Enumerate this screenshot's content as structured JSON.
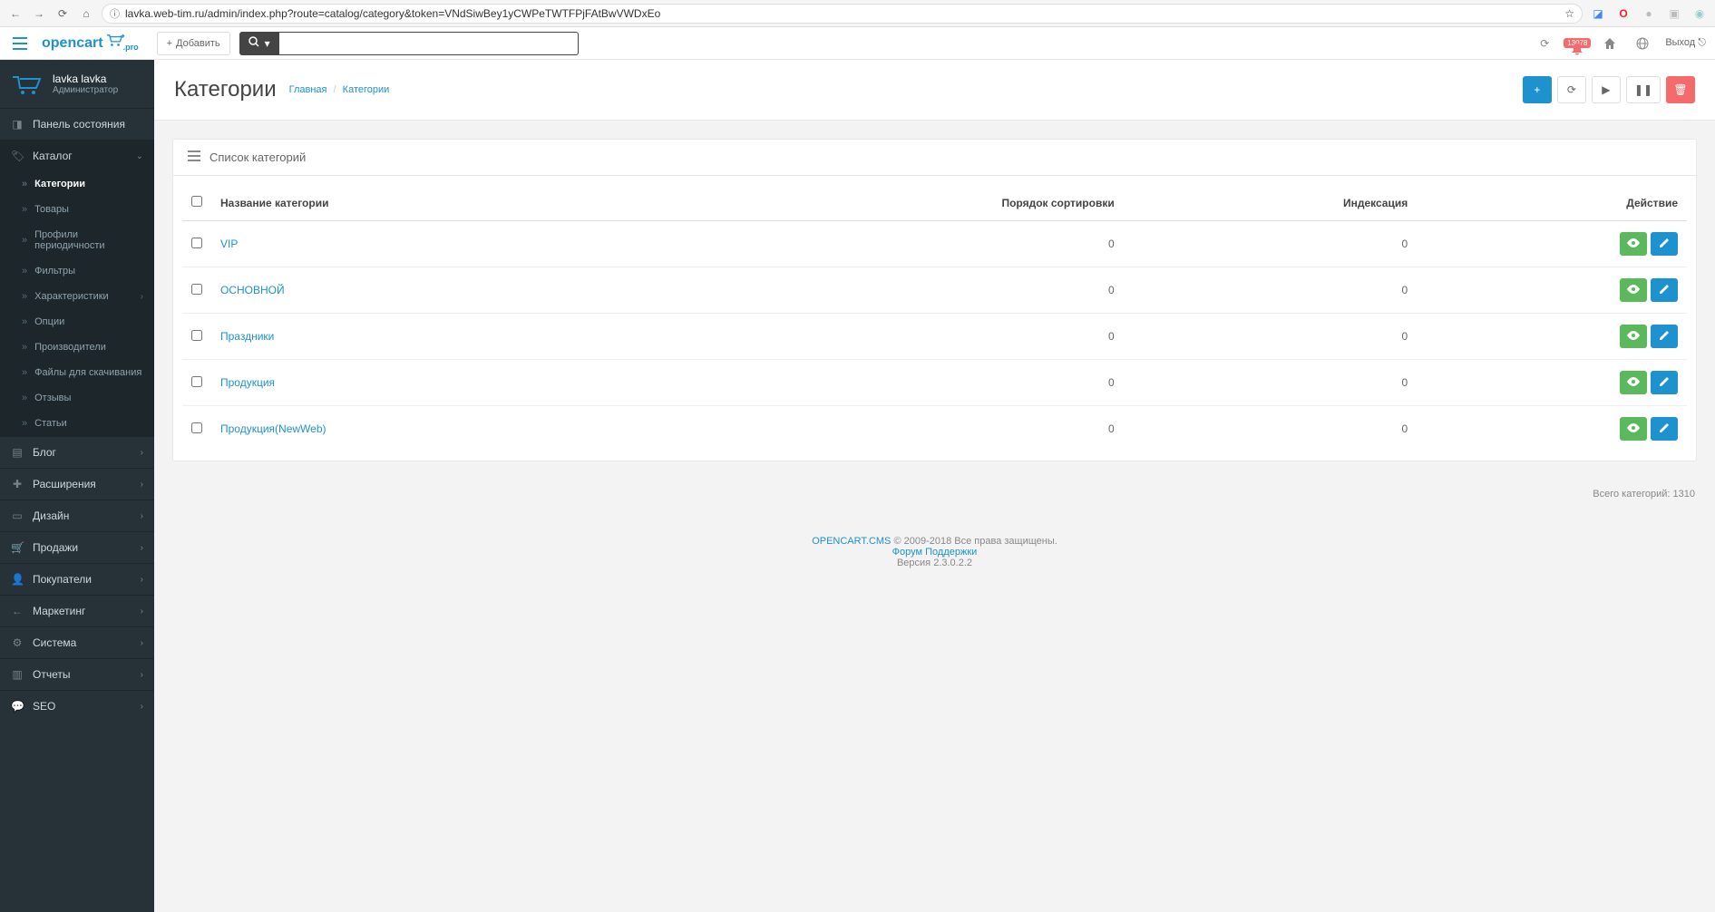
{
  "browser": {
    "url": "lavka.web-tim.ru/admin/index.php?route=catalog/category&token=VNdSiwBey1yCWPeTWTFPjFAtBwVWDxEo"
  },
  "header": {
    "logo": "opencart",
    "logo_suffix": ".pro",
    "add_label": "Добавить",
    "notif_count": "13078",
    "logout_label": "Выход"
  },
  "sidebar": {
    "user_name": "lavka lavka",
    "user_role": "Администратор",
    "menu": [
      {
        "label": "Панель состояния"
      },
      {
        "label": "Каталог",
        "expanded": true,
        "children": [
          {
            "label": "Категории",
            "active": true
          },
          {
            "label": "Товары"
          },
          {
            "label": "Профили периодичности"
          },
          {
            "label": "Фильтры"
          },
          {
            "label": "Характеристики",
            "has_children": true
          },
          {
            "label": "Опции"
          },
          {
            "label": "Производители"
          },
          {
            "label": "Файлы для скачивания"
          },
          {
            "label": "Отзывы"
          },
          {
            "label": "Статьи"
          }
        ]
      },
      {
        "label": "Блог",
        "chevron": true
      },
      {
        "label": "Расширения",
        "chevron": true
      },
      {
        "label": "Дизайн",
        "chevron": true
      },
      {
        "label": "Продажи",
        "chevron": true
      },
      {
        "label": "Покупатели",
        "chevron": true
      },
      {
        "label": "Маркетинг",
        "chevron": true
      },
      {
        "label": "Система",
        "chevron": true
      },
      {
        "label": "Отчеты",
        "chevron": true
      },
      {
        "label": "SEO",
        "chevron": true
      }
    ]
  },
  "page": {
    "title": "Категории",
    "breadcrumb_home": "Главная",
    "breadcrumb_current": "Категории"
  },
  "panel": {
    "title": "Список категорий",
    "columns": {
      "name": "Название категории",
      "sort": "Порядок сортировки",
      "index": "Индексация",
      "action": "Действие"
    },
    "rows": [
      {
        "name": "VIP",
        "sort": "0",
        "index": "0"
      },
      {
        "name": "ОСНОВНОЙ",
        "sort": "0",
        "index": "0"
      },
      {
        "name": "Праздники",
        "sort": "0",
        "index": "0"
      },
      {
        "name": "Продукция",
        "sort": "0",
        "index": "0"
      },
      {
        "name": "Продукция(NewWeb)",
        "sort": "0",
        "index": "0"
      }
    ],
    "footer_total": "Всего категорий: 1310"
  },
  "footer": {
    "link": "OPENCART.CMS",
    "copyright": " © 2009-2018 Все права защищены.",
    "forum": "Форум Поддержки",
    "version": "Версия 2.3.0.2.2"
  }
}
